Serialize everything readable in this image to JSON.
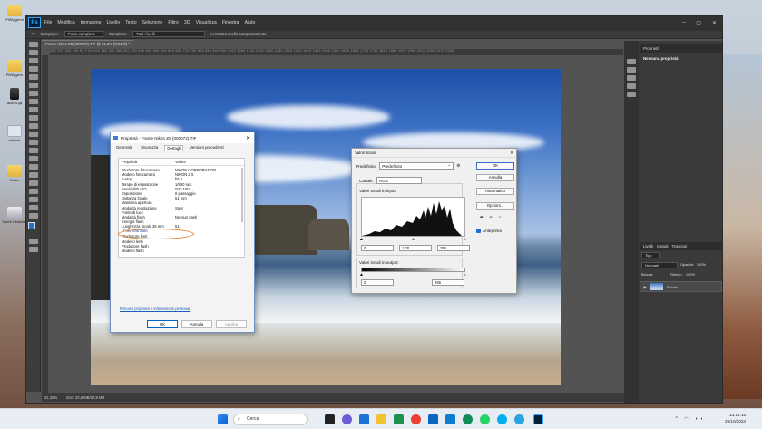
{
  "desktop": {
    "icons": [
      {
        "label": "PiWiggernt",
        "kind": "folder"
      },
      {
        "label": "PiWiggern",
        "kind": "folder"
      },
      {
        "label": "auto.4.lja",
        "kind": "usb"
      },
      {
        "label": "rete.lnk",
        "kind": "shortcut"
      },
      {
        "label": "Raiko",
        "kind": "folder"
      },
      {
        "label": "Snere Cestinhe",
        "kind": "recycle"
      }
    ]
  },
  "photoshop": {
    "logo": "Ps",
    "menu": [
      "File",
      "Modifica",
      "Immagine",
      "Livello",
      "Testo",
      "Selezione",
      "Filtro",
      "3D",
      "Visualizza",
      "Finestra",
      "Aiuto"
    ],
    "options": {
      "sample_label": "Campione:",
      "sample_value": "Punto campione",
      "sample2_label": "Campione:",
      "sample2_value": "Tutti i livelli",
      "show_ring": "Mostra anello campionamento"
    },
    "doc_tab": "Frame Nikon Z5 (000072).TIF @ 31,3% (RGB/8) *",
    "ruler_ticks": "250 200 150 100 50 0 50 100 150 200 250 300 350 400 450 500 550 600 650 700 750 800 850 900 950 1000 1050 1100 1150 1200 1250 1300 1350 1400 1450 1500 1550 1600 1650 1700 1750 1800 1850 1900 1950 2000 2050 2100 2150",
    "status": {
      "zoom": "31,33%",
      "doc": "Doc: 22,9 MB/22,9 MB"
    },
    "panels": {
      "properties_tab": "Proprietà",
      "properties_body": "Nessuna proprietà",
      "layers_tabs": [
        "Livelli",
        "Canali",
        "Tracciati"
      ],
      "layer_kind": "Tipo",
      "blend_mode": "Normale",
      "opacity_label": "Opacità:",
      "opacity_value": "100%",
      "lock_label": "Blocca:",
      "fill_label": "Riemp.:",
      "fill_value": "100%",
      "layer_name": "Sfondo"
    }
  },
  "file_properties": {
    "title": "Proprietà - Frame Nikon Z5 (000072).TIF",
    "tabs": [
      "Generale",
      "Sicurezza",
      "Dettagli",
      "Versioni precedenti"
    ],
    "active_tab": "Dettagli",
    "columns": [
      "Proprietà",
      "Valore"
    ],
    "rows": [
      {
        "k": "Produttore fotocamera",
        "v": "NIKON CORPORATION"
      },
      {
        "k": "Modello fotocamera",
        "v": "NIKON Z 5"
      },
      {
        "k": "F-stop",
        "v": "f/5.6"
      },
      {
        "k": "Tempo di esposizione",
        "v": "1/800 sec."
      },
      {
        "k": "Sensibilità ISO",
        "v": "ISO-100"
      },
      {
        "k": "Esposizione",
        "v": "0 passaggio"
      },
      {
        "k": "Distanza focale",
        "v": "51 mm"
      },
      {
        "k": "Massima apertura",
        "v": ""
      },
      {
        "k": "Modalità regolazione",
        "v": "Spot"
      },
      {
        "k": "Fonte di luce",
        "v": ""
      },
      {
        "k": "Modalità flash",
        "v": "Nessun flash"
      },
      {
        "k": "Energia flash",
        "v": ""
      },
      {
        "k": "Lunghezza focale 35 mm",
        "v": "51"
      }
    ],
    "section2": "Foto avanzata",
    "rows2": [
      {
        "k": "Produttore lenti",
        "v": ""
      },
      {
        "k": "Modello lenti",
        "v": ""
      },
      {
        "k": "Produttore flash",
        "v": ""
      },
      {
        "k": "Modello flash",
        "v": ""
      }
    ],
    "link": "Rimuovi proprietà e informazioni personali",
    "buttons": {
      "ok": "OK",
      "cancel": "Annulla",
      "apply": "Applica"
    }
  },
  "levels": {
    "title": "Valori tonali",
    "preset_label": "Predefinito:",
    "preset_value": "Predefinito",
    "channel_label": "Canale:",
    "channel_value": "RGB",
    "input_label": "Valori tonali in input:",
    "input_values": [
      "0",
      "1,00",
      "255"
    ],
    "output_label": "Valori tonali in output:",
    "output_values": [
      "0",
      "255"
    ],
    "buttons": {
      "ok": "OK",
      "cancel": "Annulla",
      "auto": "Automatico",
      "options": "Opzioni..."
    },
    "preview_label": "Anteprima"
  },
  "taskbar": {
    "search_placeholder": "Cerca",
    "time": "13:12:15",
    "date": "29/10/2023"
  }
}
